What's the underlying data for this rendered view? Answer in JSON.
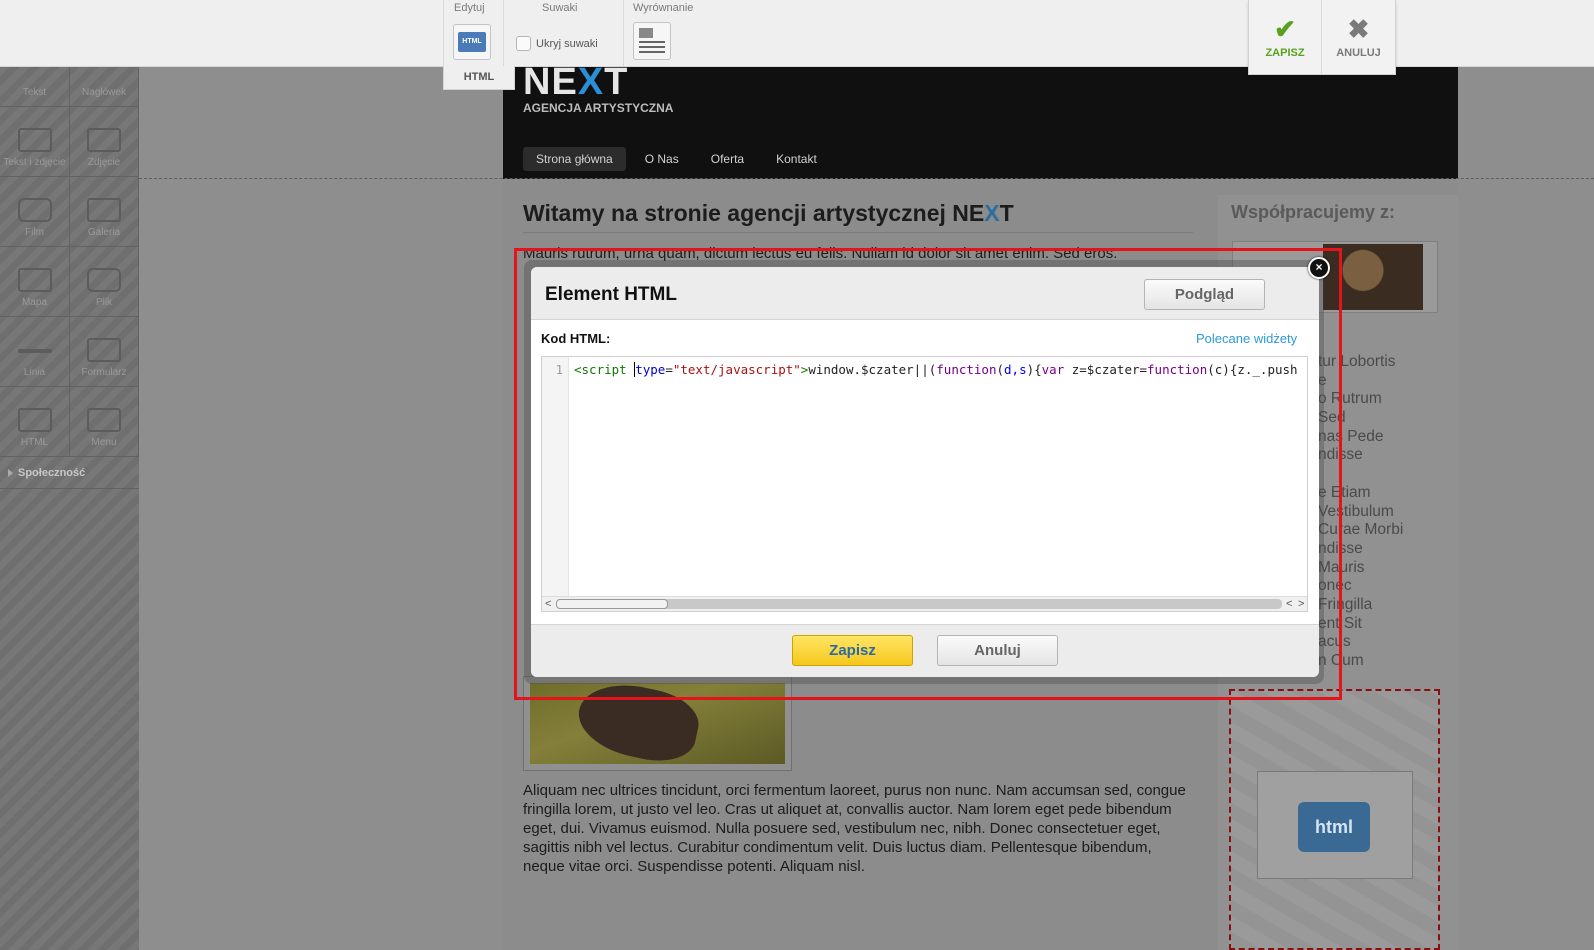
{
  "toolbar": {
    "edit": {
      "label": "Edytuj",
      "html_icon": "HTML",
      "tab_label": "HTML"
    },
    "sliders": {
      "label": "Suwaki",
      "hide_label": "Ukryj suwaki"
    },
    "align": {
      "label": "Wyrównanie"
    },
    "save_label": "ZAPISZ",
    "cancel_label": "ANULUJ"
  },
  "sidebar": {
    "tools": [
      {
        "label": "Tekst",
        "icon": "text-icon"
      },
      {
        "label": "Nagłówek",
        "icon": "heading-icon"
      },
      {
        "label": "Tekst i zdjęcie",
        "icon": "text-image-icon"
      },
      {
        "label": "Zdjęcie",
        "icon": "image-icon"
      },
      {
        "label": "Film",
        "icon": "film-icon"
      },
      {
        "label": "Galeria",
        "icon": "gallery-icon"
      },
      {
        "label": "Mapa",
        "icon": "map-icon"
      },
      {
        "label": "Plik",
        "icon": "file-icon"
      },
      {
        "label": "Linia",
        "icon": "line-icon"
      },
      {
        "label": "Formularz",
        "icon": "form-icon"
      },
      {
        "label": "HTML",
        "icon": "html-code-icon"
      },
      {
        "label": "Menu",
        "icon": "menu-icon"
      }
    ],
    "social_label": "Społeczność"
  },
  "site": {
    "logo_ne": "NE",
    "logo_x": "X",
    "logo_t": "T",
    "tagline": "AGENCJA ARTYSTYCZNA",
    "nav": [
      "Strona główna",
      "O Nas",
      "Oferta",
      "Kontakt"
    ],
    "heading_pre": "Witamy na stronie agencji artystycznej NE",
    "heading_x": "X",
    "heading_t": "T",
    "intro_text": "Mauris rutrum, urna quam, dictum lectus eu felis. Nullam id dolor sit amet enim. Sed eros.",
    "partners_heading": "Współpracujemy z:",
    "links": [
      "tur Lobortis",
      "e",
      "o Rutrum",
      "Sed",
      "nas Pede",
      "ndisse",
      "",
      "e Etiam",
      "Vestibulum",
      "Curae Morbi",
      "ndisse",
      "Mauris",
      "onec",
      "Fringilla",
      "ent Sit",
      "acus",
      "n Cum"
    ],
    "article_text": "Aliquam nec ultrices tincidunt, orci fermentum laoreet, purus non nunc. Nam accumsan sed, congue fringilla lorem, ut justo vel leo. Cras ut aliquet at, convallis auctor. Nam lorem eget pede bibendum eget, dui. Vivamus euismod. Nulla posuere sed, vestibulum nec, nibh. Donec consectetuer eget, sagittis nibh vel lectus. Curabitur condimentum velit. Duis luctus diam. Pellentesque bibendum, neque vitae orci. Suspendisse potenti. Aliquam nisl.",
    "widget_label": "html"
  },
  "modal": {
    "title": "Element HTML",
    "preview_label": "Podgląd",
    "code_label": "Kod HTML:",
    "recommended_link": "Polecane widżety",
    "line_number": "1",
    "code": {
      "tag_open": "<script ",
      "attr": "type",
      "eq": "=",
      "str": "\"text/javascript\"",
      "tag_close": ">",
      "plain1": "window.$czater||(",
      "kw_function": "function",
      "paren1": "(",
      "params": "d,s",
      "paren2": "){",
      "kw_var": "var",
      "plain2": " z=$czater=",
      "kw_function2": "function",
      "paren3": "(c){",
      "plain3": "z._.push"
    },
    "save_label": "Zapisz",
    "cancel_label": "Anuluj",
    "close_symbol": "×"
  }
}
